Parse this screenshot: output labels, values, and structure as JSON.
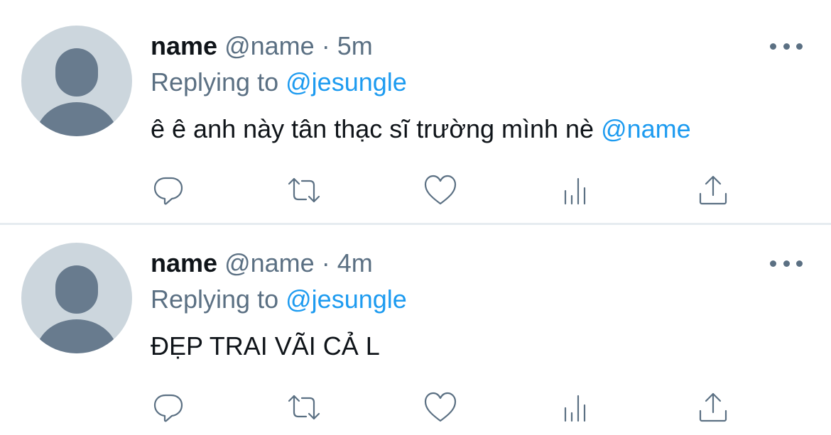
{
  "colors": {
    "link": "#1d9bf0",
    "secondary_text": "#5b7083",
    "primary_text": "#0f1419",
    "avatar_bg": "#ccd6dd",
    "avatar_fg": "#687b8e",
    "divider": "#e6ecf0"
  },
  "tweets": [
    {
      "name": "name",
      "handle": "@name",
      "separator": "·",
      "time": "5m",
      "replying_prefix": "Replying to",
      "replying_to": "@jesungle",
      "text": "ê ê anh này tân thạc sĩ trường mình nè",
      "text_mention": "@name",
      "actions": [
        "reply-icon",
        "retweet-icon",
        "like-icon",
        "stats-icon",
        "share-icon"
      ]
    },
    {
      "name": "name",
      "handle": "@name",
      "separator": "·",
      "time": "4m",
      "replying_prefix": "Replying to",
      "replying_to": "@jesungle",
      "text": "ĐẸP TRAI VÃI CẢ L",
      "text_mention": "",
      "actions": [
        "reply-icon",
        "retweet-icon",
        "like-icon",
        "stats-icon",
        "share-icon"
      ]
    }
  ]
}
